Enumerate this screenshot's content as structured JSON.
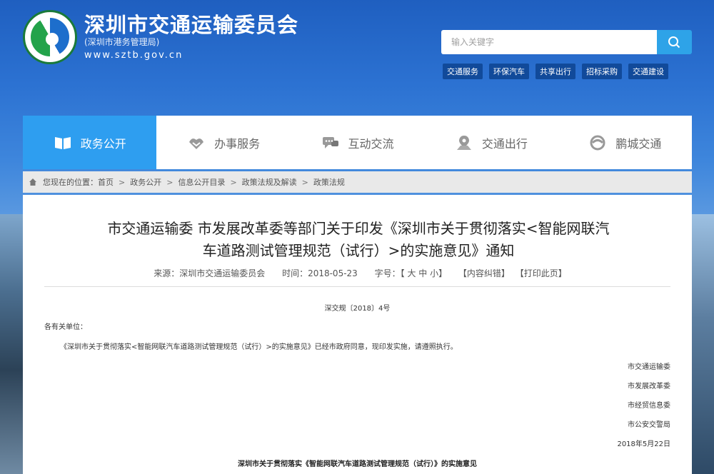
{
  "header": {
    "title": "深圳市交通运输委员会",
    "subtitle": "(深圳市港务管理局)",
    "url": "www.sztb.gov.cn",
    "search_placeholder": "输入关键字",
    "quick_links": [
      "交通服务",
      "环保汽车",
      "共享出行",
      "招标采购",
      "交通建设"
    ]
  },
  "nav": {
    "items": [
      {
        "label": "政务公开",
        "icon": "book-icon"
      },
      {
        "label": "办事服务",
        "icon": "handshake-icon"
      },
      {
        "label": "互动交流",
        "icon": "chat-icon"
      },
      {
        "label": "交通出行",
        "icon": "map-pin-icon"
      },
      {
        "label": "鹏城交通",
        "icon": "swirl-logo-icon"
      }
    ],
    "active_index": 0
  },
  "breadcrumb": {
    "prefix": "您现在的位置：",
    "items": [
      "首页",
      "政务公开",
      "信息公开目录",
      "政策法规及解读",
      "政策法规"
    ],
    "separator": ">"
  },
  "article": {
    "title_line1": "市交通运输委 市发展改革委等部门关于印发《深圳市关于贯彻落实<智能网联汽",
    "title_line2": "车道路测试管理规范（试行）>的实施意见》通知",
    "source": "来源：深圳市交通运输委员会",
    "time": "时间：2018-05-23",
    "font_size_label": "字号：【 大 中 小】",
    "error_link": "【内容纠错】",
    "print_link": "【打印此页】",
    "doc_number": "深交规〔2018〕4号",
    "salutation": "各有关单位：",
    "body": "《深圳市关于贯彻落实<智能网联汽车道路测试管理规范（试行）>的实施意见》已经市政府同意，现印发实施，请遵照执行。",
    "signatories": [
      "市交通运输委",
      "市发展改革委",
      "市经贸信息委",
      "市公安交警局"
    ],
    "date": "2018年5月22日",
    "appendix_title": "深圳市关于贯彻落实《智能网联汽车道路测试管理规范（试行）》的实施意见"
  },
  "colors": {
    "accent": "#2e9ef0",
    "quick_link_bg": "#114a9a",
    "search_button": "#2ea3e8"
  }
}
